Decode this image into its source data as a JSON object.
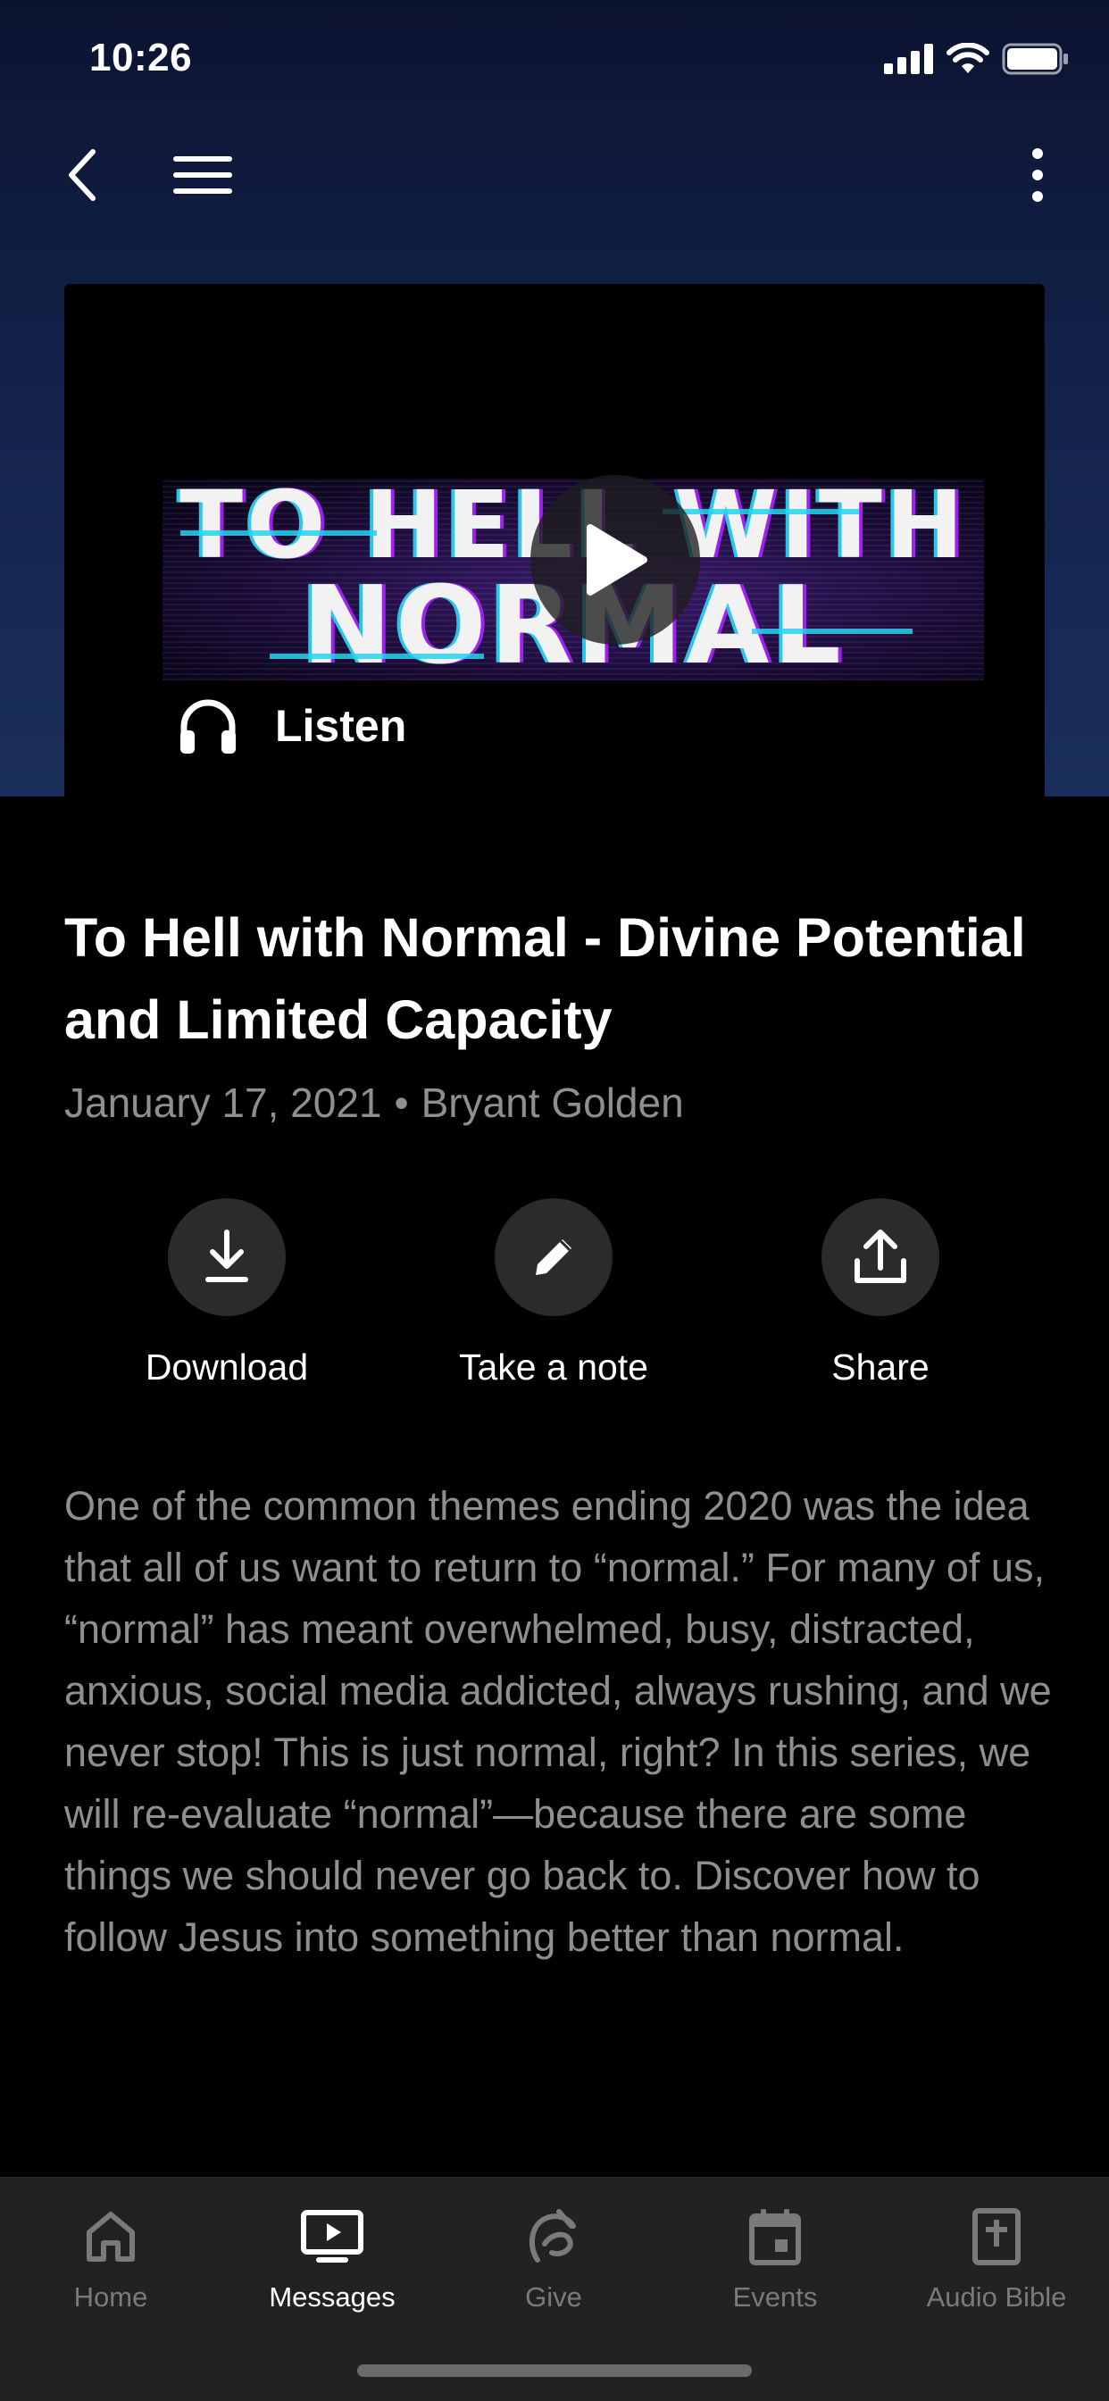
{
  "status_bar": {
    "time": "10:26"
  },
  "media": {
    "artwork_text_line1": "TO HELL WITH",
    "artwork_text_line2": "NORMAL",
    "listen_label": "Listen"
  },
  "message": {
    "title": "To Hell with Normal - Divine Potential and Limited Capacity",
    "date": "January 17, 2021",
    "separator": "•",
    "speaker": "Bryant Golden",
    "description": "One of the common themes ending 2020 was the idea that all of us want to return to “normal.” For many of us, “normal” has meant overwhelmed, busy, distracted, anxious, social media addicted, always rushing, and we never stop! This is just normal, right?  In this series, we will re-evaluate “normal”—because there are some things we should never go back to. Discover how to follow Jesus into something better than normal."
  },
  "actions": [
    {
      "label": "Download",
      "icon": "download-icon"
    },
    {
      "label": "Take a note",
      "icon": "pencil-icon"
    },
    {
      "label": "Share",
      "icon": "share-icon"
    }
  ],
  "tabs": [
    {
      "label": "Home",
      "icon": "home-icon",
      "active": false
    },
    {
      "label": "Messages",
      "icon": "tv-play-icon",
      "active": true
    },
    {
      "label": "Give",
      "icon": "give-icon",
      "active": false
    },
    {
      "label": "Events",
      "icon": "calendar-icon",
      "active": false
    },
    {
      "label": "Audio Bible",
      "icon": "bible-icon",
      "active": false
    }
  ],
  "colors": {
    "background": "#000000",
    "hero_gradient_top": "#0b1330",
    "hero_gradient_bottom": "#1a2e5c",
    "secondary_text": "#8f8f8f",
    "tabbar_bg": "#222222",
    "tab_inactive": "#7a7a7a",
    "action_circle": "#2b2b2b"
  }
}
